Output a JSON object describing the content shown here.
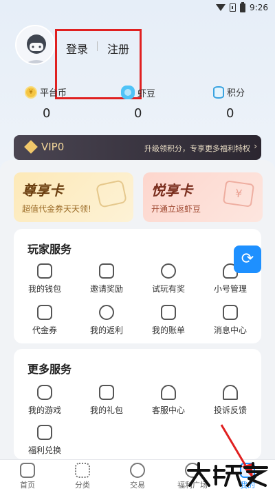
{
  "status_bar": {
    "time": "9:26"
  },
  "profile": {
    "login_label": "登录",
    "register_label": "注册"
  },
  "stats": [
    {
      "label": "平台币",
      "value": "0",
      "icon": "coin-icon"
    },
    {
      "label": "虾豆",
      "value": "0",
      "icon": "shrimp-bean-icon"
    },
    {
      "label": "积分",
      "value": "0",
      "icon": "points-icon"
    }
  ],
  "vip": {
    "level": "VIP0",
    "hint": "升级领积分，专享更多福利特权"
  },
  "promo_cards": [
    {
      "title": "尊享卡",
      "subtitle": "超值代金券天天领!"
    },
    {
      "title": "悦享卡",
      "subtitle": "开通立返虾豆"
    }
  ],
  "player_services": {
    "title": "玩家服务",
    "items": [
      "我的钱包",
      "邀请奖励",
      "试玩有奖",
      "小号管理",
      "代金券",
      "我的返利",
      "我的账单",
      "消息中心"
    ]
  },
  "more_services": {
    "title": "更多服务",
    "items": [
      "我的游戏",
      "我的礼包",
      "客服中心",
      "投诉反馈",
      "福利兑换"
    ]
  },
  "tabs": [
    {
      "label": "首页"
    },
    {
      "label": "分类"
    },
    {
      "label": "交易"
    },
    {
      "label": "福利广场"
    },
    {
      "label": "我的",
      "active": true
    }
  ],
  "watermark": {
    "text": "大玩家"
  },
  "colors": {
    "accent": "#1e90ff",
    "annotation": "#e02020",
    "vip_bar": "#3a3540"
  }
}
